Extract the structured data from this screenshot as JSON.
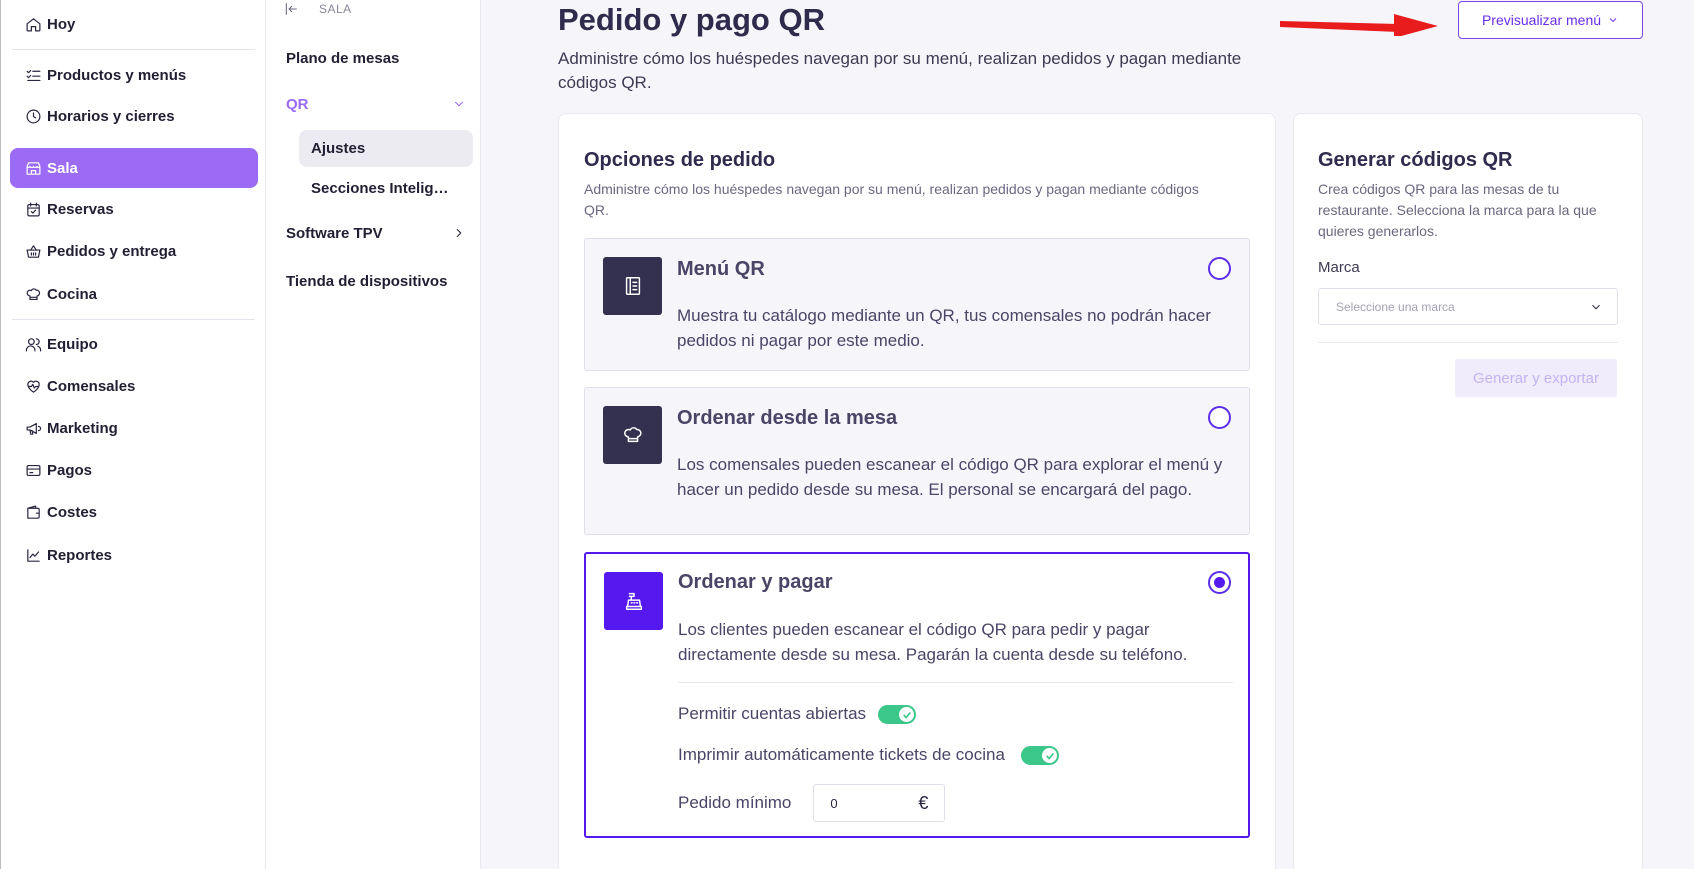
{
  "sidebar": {
    "items": [
      {
        "label": "Hoy",
        "icon": "home-icon"
      },
      {
        "label": "Productos y menús",
        "icon": "list-check-icon"
      },
      {
        "label": "Horarios y cierres",
        "icon": "clock-icon"
      },
      {
        "label": "Sala",
        "icon": "store-icon",
        "active": true
      },
      {
        "label": "Reservas",
        "icon": "calendar-check-icon"
      },
      {
        "label": "Pedidos y entrega",
        "icon": "basket-icon"
      },
      {
        "label": "Cocina",
        "icon": "chef-hat-icon"
      },
      {
        "label": "Equipo",
        "icon": "users-icon"
      },
      {
        "label": "Comensales",
        "icon": "heart-pulse-icon"
      },
      {
        "label": "Marketing",
        "icon": "megaphone-icon"
      },
      {
        "label": "Pagos",
        "icon": "credit-card-icon"
      },
      {
        "label": "Costes",
        "icon": "wallet-icon"
      },
      {
        "label": "Reportes",
        "icon": "chart-line-icon"
      }
    ]
  },
  "subnav": {
    "header": "SALA",
    "items": {
      "plano": "Plano de mesas",
      "qr": "QR",
      "ajustes": "Ajustes",
      "secciones": "Secciones Inteligentes",
      "tpv": "Software TPV",
      "tienda": "Tienda de dispositivos"
    }
  },
  "main": {
    "title": "Pedido y pago QR",
    "subtitle": "Administre cómo los huéspedes navegan por su menú, realizan pedidos y pagan mediante códigos QR.",
    "preview_button": "Previsualizar menú"
  },
  "order_options": {
    "title": "Opciones de pedido",
    "subtitle": "Administre cómo los huéspedes navegan por su menú, realizan pedidos y pagan mediante códigos QR.",
    "options": [
      {
        "title": "Menú QR",
        "description": "Muestra tu catálogo mediante un QR, tus comensales no podrán hacer pedidos ni pagar por este medio.",
        "selected": false
      },
      {
        "title": "Ordenar desde la mesa",
        "description": "Los comensales pueden escanear el código QR para explorar el menú y hacer un pedido desde su mesa. El personal se encargará del pago.",
        "selected": false
      },
      {
        "title": "Ordenar y pagar",
        "description": "Los clientes pueden escanear el código QR para pedir y pagar directamente desde su mesa. Pagarán la cuenta desde su teléfono.",
        "selected": true
      }
    ],
    "settings": {
      "open_accounts_label": "Permitir cuentas abiertas",
      "open_accounts_on": true,
      "kitchen_tickets_label": "Imprimir automáticamente tickets de cocina",
      "kitchen_tickets_on": true,
      "min_order_label": "Pedido mínimo",
      "min_order_value": "0",
      "currency": "€"
    }
  },
  "qr_generator": {
    "title": "Generar códigos QR",
    "subtitle": "Crea códigos QR para las mesas de tu restaurante. Selecciona la marca para la que quieres generarlos.",
    "brand_label": "Marca",
    "brand_placeholder": "Seleccione una marca",
    "generate_button": "Generar y exportar"
  },
  "colors": {
    "accent": "#5518ee",
    "sidebar_active": "#9b6bf5",
    "toggle_on": "#3cc78a",
    "annotation_arrow": "#e81c1c"
  }
}
